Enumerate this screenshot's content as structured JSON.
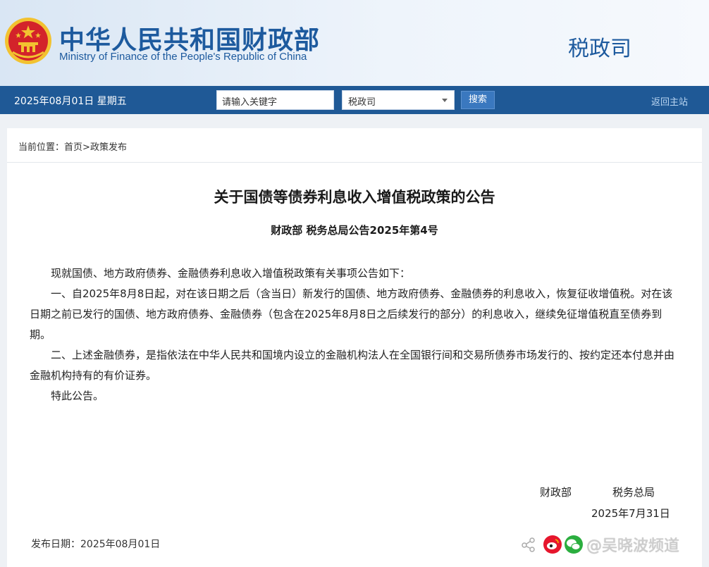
{
  "header": {
    "ministry_cn": "中华人民共和国财政部",
    "ministry_en": "Ministry of Finance of the People's Republic of China",
    "dept_title": "税政司"
  },
  "navbar": {
    "date": "2025年08月01日  星期五",
    "search_placeholder": "请输入关键字",
    "select_value": "税政司",
    "search_button": "搜索",
    "home_link": "返回主站"
  },
  "breadcrumb": {
    "label": "当前位置：",
    "home": "首页",
    "separator": ">",
    "current": "政策发布"
  },
  "article": {
    "title": "关于国债等债券利息收入增值税政策的公告",
    "doc_number": "财政部  税务总局公告2025年第4号",
    "paragraphs": [
      "现就国债、地方政府债券、金融债券利息收入增值税政策有关事项公告如下：",
      "一、自2025年8月8日起，对在该日期之后（含当日）新发行的国债、地方政府债券、金融债券的利息收入，恢复征收增值税。对在该日期之前已发行的国债、地方政府债券、金融债券（包含在2025年8月8日之后续发行的部分）的利息收入，继续免征增值税直至债券到期。",
      "二、上述金融债券，是指依法在中华人民共和国境内设立的金融机构法人在全国银行间和交易所债券市场发行的、按约定还本付息并由金融机构持有的有价证券。",
      "特此公告。"
    ],
    "signature_org1": "财政部",
    "signature_org2": "税务总局",
    "signature_date": "2025年7月31日",
    "publish_date": "发布日期：2025年08月01日"
  },
  "watermark": {
    "text": "@吴晓波频道"
  },
  "colors": {
    "brand_blue": "#1d5a9e",
    "navbar_bg": "#1f5996",
    "emblem_red": "#d3232a",
    "emblem_gold": "#f2c230"
  }
}
